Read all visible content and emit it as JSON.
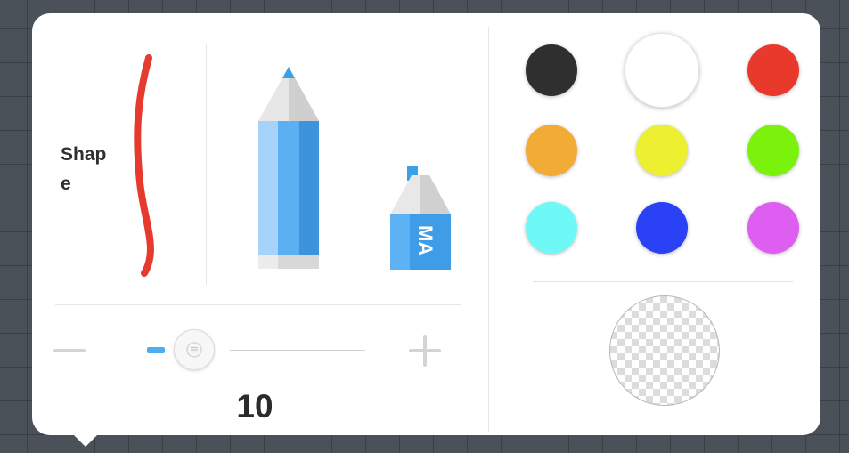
{
  "brush_panel": {
    "shape_label": "Shape",
    "shape_stroke_color": "#e63a2f",
    "tools": [
      {
        "name": "pencil",
        "icon": "pencil-icon"
      },
      {
        "name": "marker",
        "icon": "marker-icon",
        "label": "MA"
      }
    ],
    "size": {
      "value": "10",
      "minus_icon": "minus-icon",
      "plus_icon": "plus-icon",
      "accent": "#4aaef0"
    }
  },
  "color_panel": {
    "swatches": [
      {
        "color": "#2f2f2f",
        "name": "black"
      },
      {
        "color": "#ffffff",
        "name": "white",
        "selected": true
      },
      {
        "color": "#e8392c",
        "name": "red"
      },
      {
        "color": "#f2ab35",
        "name": "orange"
      },
      {
        "color": "#ecf031",
        "name": "yellow"
      },
      {
        "color": "#7af20c",
        "name": "green"
      },
      {
        "color": "#6ef8f6",
        "name": "cyan"
      },
      {
        "color": "#2b41f5",
        "name": "blue"
      },
      {
        "color": "#df5ef2",
        "name": "purple"
      }
    ],
    "transparent_swatch": "transparent-color-icon"
  }
}
